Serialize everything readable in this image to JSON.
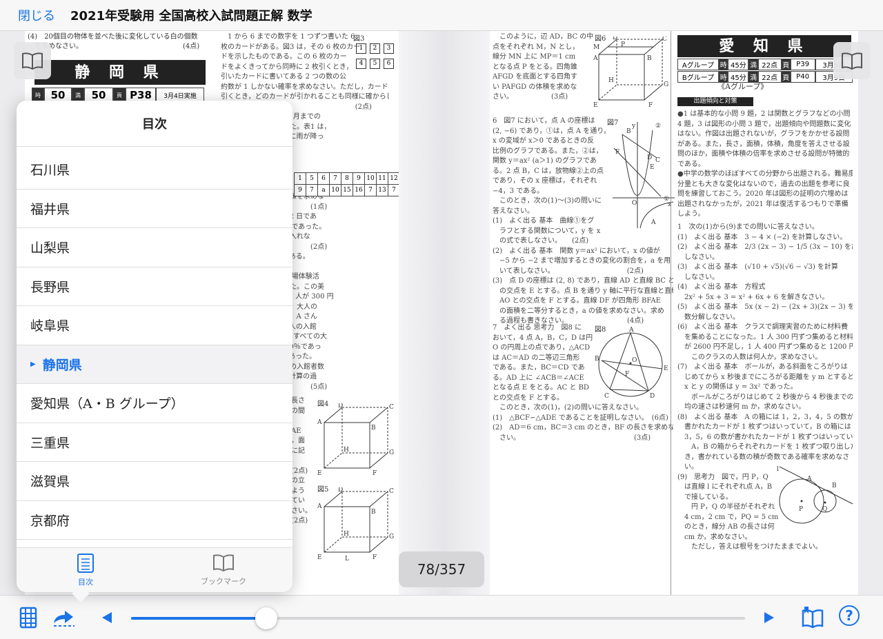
{
  "header": {
    "close_label": "閉じる",
    "title": "2021年受験用 全国高校入試問題正解 数学"
  },
  "left_page": {
    "prefecture": "静 岡 県",
    "stats": {
      "time": "50",
      "time_unit": "分",
      "score": "50",
      "score_unit": "点",
      "page": "P38",
      "date": "3月4日実施"
    },
    "top_text": "(4)　20個目の物体を並べた後に変化している白の個数\n　を求めなさい。　　　　　　　　　　　　　　　(4点)",
    "col2": [
      "　1 から 6 までの数字を 1 つずつ書いた 6",
      "枚のカードがある。図3 は，その 6 枚のカー",
      "ドを示したものである。この 6 枚のカー",
      "ドをよくきってから同時に 2 枚引くとき，",
      "引いたカードに書いてある 2 つの数の公",
      "約数が 1 しかない確率を求めなさい。ただし，カードを",
      "引くとき，どのカードが引かれることも同様に確からし",
      "いとする。　　　　　　　　　　　　　　　(2点)",
      "る都市の，1月から 12 月までの",
      "雨が降った日数を調べた。表1 は，",
      "である。ただし，6 月に雨が降っ",
      "",
      "の問いに答えなさい。",
      "",
      "",
      "",
      "雨が降った日数の最頻値を求めな",
      "　　　　　　　　　　　　　(1点)",
      "降った日数の範囲は 12 日であ",
      "日数の中央値は 8.5 日であった。",
      "に当てはまる数を書き入れな",
      "　　　　　　　　　　　　　(2点)",
      "は，　　≦ a ≦　　 である。",
      "",
      "る中学校の 2 年生が職場体験活",
      "さんは美術館で活動した。この美",
      "人が 500 円，子ども 1 人が 300 円",
      "歳以上の人の入館料は，大人の",
      "美術館が閉館した後に，A さん",
      "たところ，すべての大人の入館",
      "を合わせて 183 人で，すべての大",
      "歳以上の人の合計は 20％であっ",
      "の合計は 76750 円であった。",
      "人の入館者数と子どもの入館者数",
      "か。方程式をつくり，計算の過",
      "　　　　　　　　　　　　　(5点)"
    ],
    "fig3_label": "図3",
    "fig3_cards": [
      "1",
      "2",
      "3",
      "4",
      "5",
      "6"
    ],
    "table_row1": [
      "1",
      "5",
      "6",
      "7",
      "8",
      "9",
      "10",
      "11",
      "12"
    ],
    "table_row2": [
      "9",
      "7",
      "a",
      "10",
      "15",
      "16",
      "7",
      "13",
      "7"
    ],
    "fig4_label": "図4",
    "fig5_label": "図5",
    "cube_labels": [
      "D",
      "C",
      "A",
      "B",
      "H",
      "G",
      "E",
      "F",
      "L"
    ],
    "mid_text": [
      "長さ",
      "の間",
      "",
      "AE",
      "，面",
      "に記",
      "",
      "(2点)",
      "の立",
      "よう",
      "てい",
      "さい。",
      "(2点)"
    ]
  },
  "middle_page": {
    "col1": [
      "　このように，辺 AD，BC の中",
      "点をそれぞれ M，N とし，",
      "線分 MN 上に MP＝1 cm",
      "となる点 P をとる。四角錐",
      "AFGD を底面とする四角す",
      "い PAFGD の体積を求めな",
      "さい。　　　　　　(3点)"
    ],
    "fig6_label": "図6",
    "q6": [
      "6　図7 において，点 A の座標は",
      "(2, −6) であり，①は，点 A を通り，",
      "x の変域が x＞0 であるときの反",
      "比例のグラフである。また，②は，",
      "関数 y＝ax² (a＞1) のグラフであ",
      "る。2 点 B，C は，放物線②上の点",
      "であり，その x 座標は，それぞれ",
      "−4，3 である。",
      "　このとき，次の(1)〜(3)の問いに",
      "答えなさい。",
      "(1)　よく出る 基本　曲線①をグ",
      "　ラフとする関数について，y を x",
      "　の式で表しなさい。　　(2点)",
      "(2)　よく出る 基本　関数 y＝ax² において，x の値が",
      "　−5 から −2 まで増加するときの変化の割合を，a を用",
      "　いて表しなさい。　　　　　　　　　　　(2点)",
      "(3)　点 D の座標は (2, 8) であり，直線 AD と直線 BC と",
      "　の交点を E とする。点 B を通り y 軸に平行な直線と直線",
      "　AO との交点を F とする。直線 DF が四角形 BFAE",
      "　の面積を二等分するとき，a の値を求めなさい。求め",
      "　る過程も書きなさい。　　　　　　　　　(4点)"
    ],
    "fig7_label": "図7",
    "q7": [
      "7　よく出る 思考力　図8 に",
      "おいて，4 点 A，B，C，D は円",
      "O の円周上の点であり，△ACD",
      "は AC＝AD の二等辺三角形",
      "である。また，BC＝CD であ",
      "る。AD 上に ∠ACB＝∠ACE",
      "となる点 E をとる。AC と BD",
      "との交点を F とする。",
      "　このとき，次の(1)，(2)の問いに答えなさい。",
      "(1)　△BCF∽△ADE であることを証明しなさい。　(6点)",
      "(2)　AD＝6 cm，BC＝3 cm のとき，BF の長さを求めな",
      "　さい。　　　　　　　　　　　　　　　　　(3点)"
    ],
    "fig8_label": "図8"
  },
  "right_page": {
    "prefecture": "愛 知 県",
    "groups": [
      {
        "name": "Aグループ",
        "time": "45分",
        "score": "22点",
        "page": "P39",
        "date": "3月5日"
      },
      {
        "name": "Bグループ",
        "time": "45分",
        "score": "22点",
        "page": "P40",
        "date": "3月9日"
      }
    ],
    "subtitle": "《Aグループ》",
    "trend_label": "出題傾向と対策",
    "trend": [
      "●1 は基本的な小問 9 題，2 は関数とグラフなどの小問",
      "4 題，3 は図形の小問 3 題で，出題傾向や問題数に変化",
      "はない。作図は出題されないが，グラフをかかせる設問",
      "がある。また，長さ，面積，体積，角度を答えさせる設",
      "問のほか，面積や体積の倍率を求めさせる設問が特徴的",
      "である。",
      "●中学の数学のほぼすべての分野から出題される。難易度，",
      "分量とも大きな変化はないので，過去の出題を参考に良",
      "問を練習しておこう。2020 年は図形の証明の穴埋めは",
      "出題されなかったが，2021 年は復活するつもりで準備",
      "しよう。"
    ],
    "q1": [
      "1　次の(1)から(9)までの問いに答えなさい。",
      "(1)　よく出る 基本　3 − 4 × (−2) を計算しなさい。",
      "(2)　よく出る 基本　2/3 (2x − 3) − 1/5 (3x − 10) を計算",
      "　しなさい。",
      "(3)　よく出る 基本　(√10 + √5)(√6 − √3) を計算",
      "　しなさい。",
      "(4)　よく出る 基本　方程式",
      "　2x² + 5x + 3 = x² + 6x + 6 を解きなさい。",
      "(5)　よく出る 基本　5x (x − 2) − (2x + 3)(2x − 3) を因",
      "　数分解しなさい。",
      "(6)　よく出る 基本　クラスで調理実習のために材料費",
      "　を集めることになった。1 人 300 円ずつ集めると材料費",
      "　が 2600 円不足し，1 人 400 円ずつ集めると 1200 円余る。",
      "　　このクラスの人数は何人か，求めなさい。",
      "(7)　よく出る 基本　ボールが，ある斜面をころがりは",
      "　じめてから x 秒後までにころがる距離を y m とすると，",
      "　x と y の関係は y = 3x² であった。",
      "　　ボールがころがりはじめて 2 秒後から 4 秒後までの平",
      "　均の速さは秒速何 m か，求めなさい。",
      "(8)　よく出る 基本　A の箱には 1，2，3，4，5 の数が",
      "　書かれたカードが 1 枚ずつはいっていて，B の箱には 1，",
      "　3，5，6 の数が書かれたカードが 1 枚ずつはいっている。",
      "　　A，B の箱からそれぞれカードを 1 枚ずつ取り出したと",
      "　き，書かれている数の積が奇数である確率を求めなさ",
      "　い。",
      "(9)　思考力　図で，円 P，Q",
      "　は直線 l にそれぞれ点 A，B",
      "　で接している。",
      "　　円 P，Q の半径がそれぞれ",
      "　4 cm，2 cm で，PQ = 5 cm",
      "　のとき，線分 AB の長さは何",
      "　cm か，求めなさい。",
      "　　ただし，答えは根号をつけたままでよい。"
    ]
  },
  "page_counter": "78/357",
  "toc": {
    "title": "目次",
    "items": [
      "石川県",
      "福井県",
      "山梨県",
      "長野県",
      "岐阜県",
      "静岡県",
      "愛知県（A・B グループ）",
      "三重県",
      "滋賀県",
      "京都府"
    ],
    "active_index": 5,
    "tabs": [
      {
        "label": "目次",
        "icon": "list-icon"
      },
      {
        "label": "ブックマーク",
        "icon": "open-book-icon"
      }
    ]
  },
  "toolbar": {
    "progress": 0.22,
    "icons": [
      "grid-pages-icon",
      "share-arrow-icon",
      "prev-page-icon",
      "next-page-icon",
      "bookmark-book-icon",
      "help-icon"
    ],
    "help_label": "?"
  },
  "colors": {
    "accent": "#1a73e8"
  }
}
